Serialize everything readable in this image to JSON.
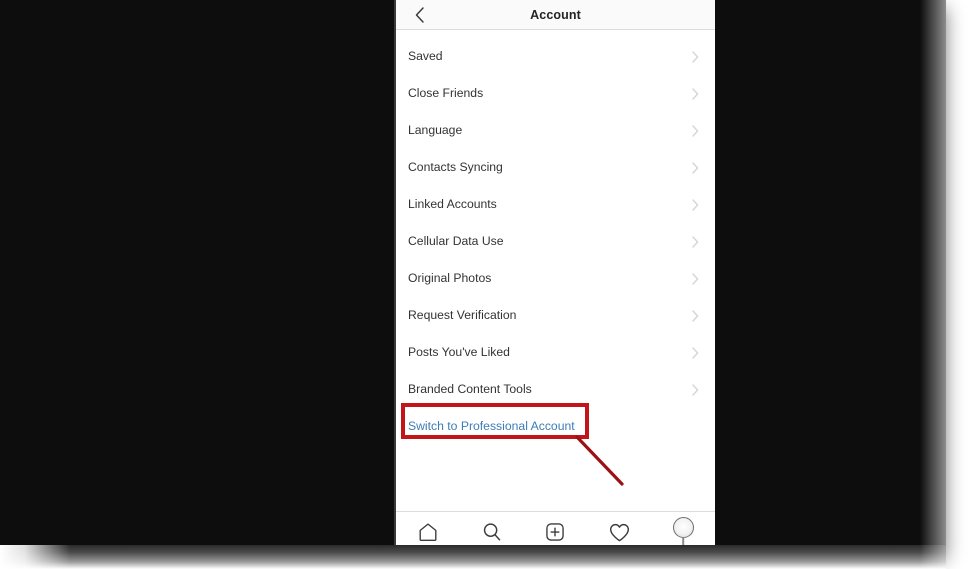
{
  "header": {
    "title": "Account",
    "back_icon": "chevron-left-icon"
  },
  "list": {
    "items": [
      {
        "label": "Saved",
        "chevron": "chevron-right-icon"
      },
      {
        "label": "Close Friends",
        "chevron": "chevron-right-icon"
      },
      {
        "label": "Language",
        "chevron": "chevron-right-icon"
      },
      {
        "label": "Contacts Syncing",
        "chevron": "chevron-right-icon"
      },
      {
        "label": "Linked Accounts",
        "chevron": "chevron-right-icon"
      },
      {
        "label": "Cellular Data Use",
        "chevron": "chevron-right-icon"
      },
      {
        "label": "Original Photos",
        "chevron": "chevron-right-icon"
      },
      {
        "label": "Request Verification",
        "chevron": "chevron-right-icon"
      },
      {
        "label": "Posts You've Liked",
        "chevron": "chevron-right-icon"
      },
      {
        "label": "Branded Content Tools",
        "chevron": "chevron-right-icon"
      }
    ],
    "professional_account": {
      "label": "Switch to Professional Account",
      "color": "#3d7cb5"
    }
  },
  "annotation": {
    "highlight_color": "#c1151a",
    "target_label": "Switch to Professional Account"
  },
  "tabbar": {
    "items": [
      {
        "name": "home-icon",
        "label": "Home"
      },
      {
        "name": "search-icon",
        "label": "Search"
      },
      {
        "name": "add-post-icon",
        "label": "Add Post"
      },
      {
        "name": "heart-icon",
        "label": "Activity"
      },
      {
        "name": "profile-avatar-icon",
        "label": "Profile"
      }
    ]
  },
  "colors": {
    "background": "#0d0d0d",
    "screen": "#ffffff",
    "header_bg": "#fafafa",
    "text": "#333333",
    "link": "#3d7cb5",
    "annotation": "#c1151a",
    "chevron": "#d5d5d5"
  }
}
